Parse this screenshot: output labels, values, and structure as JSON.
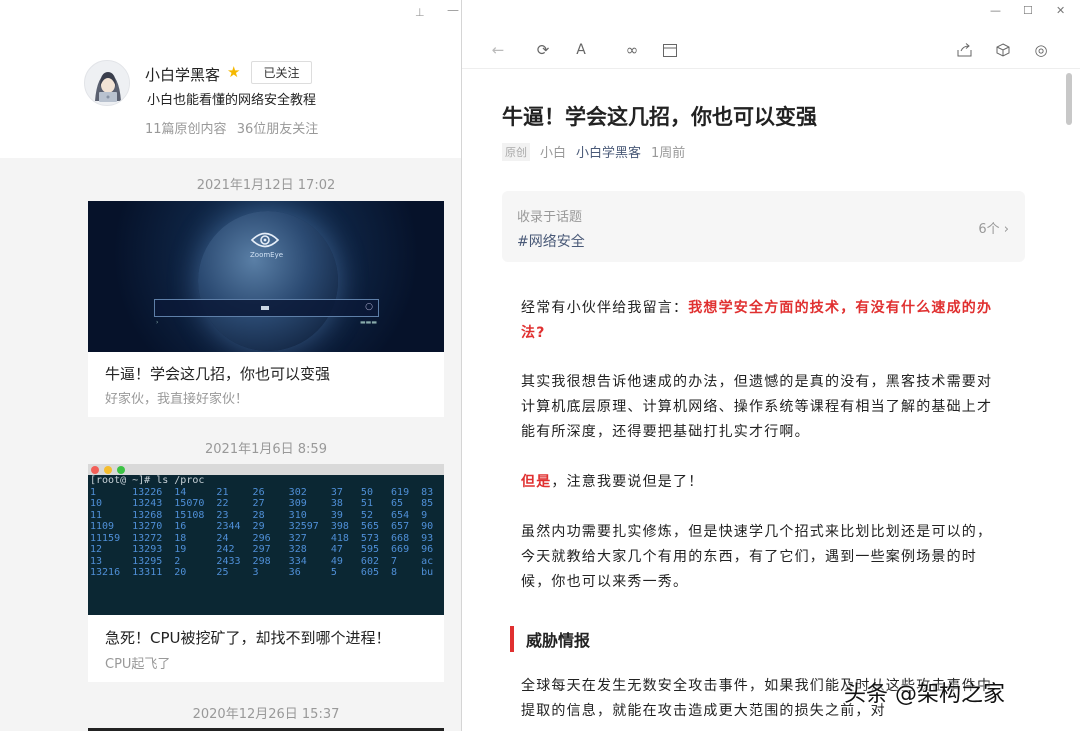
{
  "left": {
    "author": {
      "name": "小白学黑客",
      "follow_label": "已关注",
      "bio": "小白也能看懂的网络安全教程",
      "stats": [
        "11篇原创内容",
        "36位朋友关注"
      ]
    },
    "feed": [
      {
        "date": "2021年1月12日 17:02",
        "title": "牛逼！学会这几招，你也可以变强",
        "subtitle": "好家伙，我直接好家伙！",
        "thumb_text": "ZoomEye"
      },
      {
        "date": "2021年1月6日 8:59",
        "title": "急死！CPU被挖矿了，却找不到哪个进程！",
        "subtitle": "CPU起飞了"
      },
      {
        "date": "2020年12月26日 15:37"
      }
    ],
    "terminal": {
      "prompt": "[root@ ~]# ls /proc",
      "rows": [
        "1      13226  14     21    26    302    37   50   619  83",
        "10     13243  15070  22    27    309    38   51   65   85",
        "11     13268  15108  23    28    310    39   52   654  9",
        "1109   13270  16     2344  29    32597  398  565  657  90",
        "11159  13272  18     24    296   327    418  573  668  93",
        "12     13293  19     242   297   328    47   595  669  96",
        "13     13295  2      2433  298   334    49   602  7    ac",
        "13216  13311  20     25    3     36     5    605  8    bu"
      ]
    }
  },
  "article": {
    "title": "牛逼！学会这几招，你也可以变强",
    "badge": "原创",
    "source": "小白",
    "author": "小白学黑客",
    "time": "1周前",
    "topic_label": "收录于话题",
    "topic_tag": "#网络安全",
    "topic_count": "6个 ›",
    "p1_a": "经常有小伙伴给我留言：",
    "p1_b": "我想学安全方面的技术，有没有什么速成的办法?",
    "p2": "其实我很想告诉他速成的办法，但遗憾的是真的没有，黑客技术需要对计算机底层原理、计算机网络、操作系统等课程有相当了解的基础上才能有所深度，还得要把基础打扎实才行啊。",
    "p3_a": "但是",
    "p3_b": "，注意我要说但是了！",
    "p4": "虽然内功需要扎实修炼，但是快速学几个招式来比划比划还是可以的，今天就教给大家几个有用的东西，有了它们，遇到一些案例场景的时候，你也可以来秀一秀。",
    "section": "威胁情报",
    "p5": "全球每天在发生无数安全攻击事件，如果我们能及时从这些攻击事件中提取的信息，就能在攻击造成更大范围的损失之前，对"
  },
  "watermark": "头条 @架构之家",
  "icons": {
    "back": "arrow-left-icon",
    "refresh": "refresh-icon",
    "font": "font-size-icon",
    "link": "link-icon",
    "layout": "window-icon",
    "share": "share-icon",
    "cube": "cube-icon",
    "more": "more-icon",
    "pin": "pin-icon",
    "star": "star-icon"
  },
  "colors": {
    "accent_red": "#e03030",
    "link_blue": "#4a5a78",
    "star": "#f5b800"
  }
}
